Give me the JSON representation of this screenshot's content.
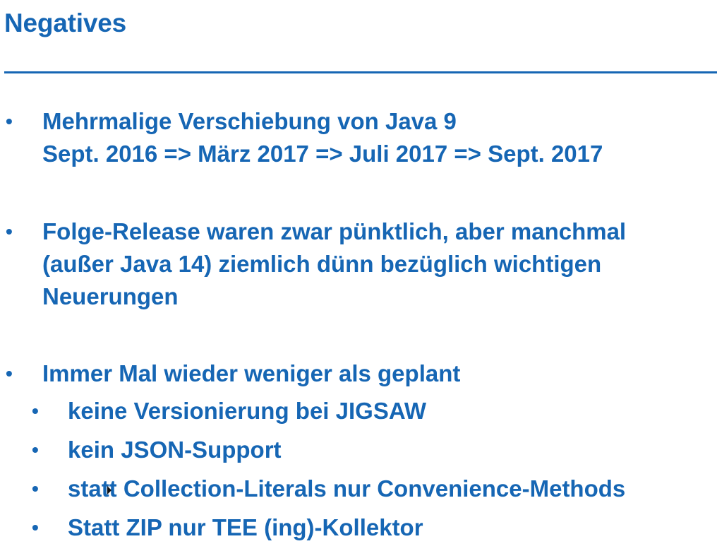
{
  "title": "Negatives",
  "bullets": [
    {
      "text": "Mehrmalige Verschiebung von Java 9\nSept. 2016 => März 2017 => Juli 2017 => Sept. 2017"
    },
    {
      "text": "Folge-Release waren zwar pünktlich, aber manchmal\n(außer Java 14) ziemlich dünn bezüglich wichtigen\nNeuerungen"
    },
    {
      "text": "Immer Mal wieder weniger als geplant",
      "sub": [
        "keine Versionierung bei JIGSAW",
        "kein JSON-Support",
        "statt Collection-Literals nur Convenience-Methods",
        "Statt ZIP nur TEE (ing)-Kollektor"
      ]
    }
  ],
  "bullet_symbol": "•",
  "colors": {
    "text": "#1666b4",
    "background": "#ffffff"
  }
}
